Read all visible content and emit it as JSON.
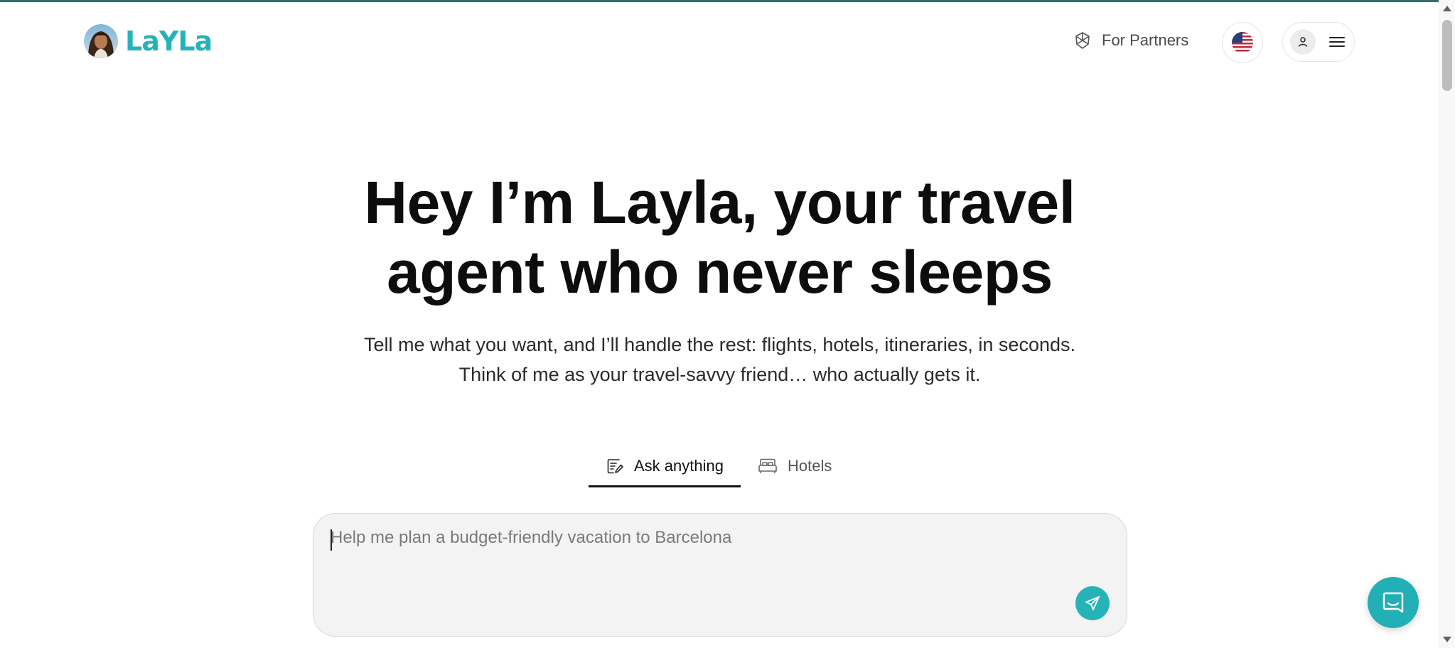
{
  "brand": {
    "name": "LaYLa",
    "accent_color": "#26b3b8"
  },
  "header": {
    "partners_label": "For Partners",
    "partners_icon": "partners-network-icon",
    "language": {
      "flag": "us-flag-icon"
    },
    "account": {
      "user_icon": "user-icon",
      "menu_icon": "hamburger-menu-icon"
    }
  },
  "hero": {
    "title_line1": "Hey I’m Layla, your travel",
    "title_line2": "agent who never sleeps",
    "subtitle_line1": "Tell me what you want, and I’ll handle the rest: flights, hotels, itineraries, in seconds.",
    "subtitle_line2": "Think of me as your travel-savvy friend… who actually gets it."
  },
  "tabs": [
    {
      "label": "Ask anything",
      "icon": "edit-note-icon",
      "active": true
    },
    {
      "label": "Hotels",
      "icon": "bed-icon",
      "active": false
    }
  ],
  "chat": {
    "placeholder": "Help me plan a budget-friendly vacation to Barcelona",
    "value": "",
    "send_icon": "send-icon"
  },
  "launcher": {
    "icon": "chat-bubble-icon"
  }
}
